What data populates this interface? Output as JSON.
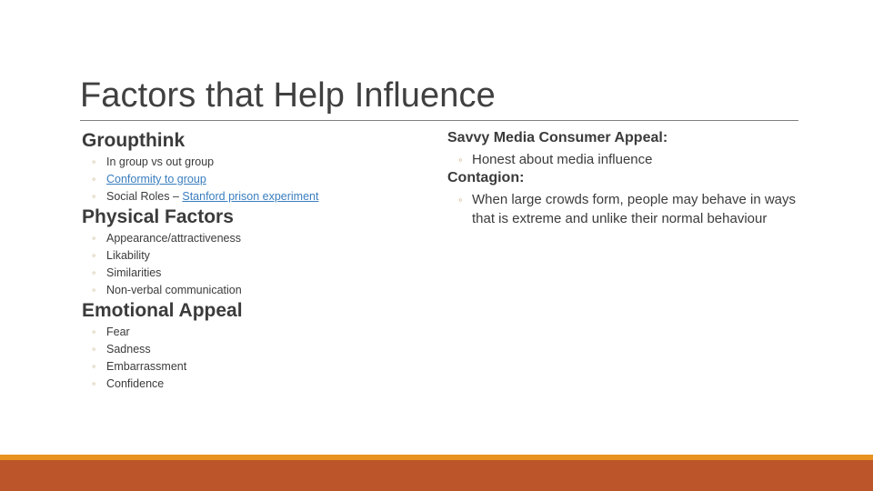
{
  "slide": {
    "title": "Factors that Help Influence",
    "colors": {
      "title_text": "#404040",
      "body_text": "#3b3b3b",
      "bullet_marker": "#bfa97a",
      "hyperlink": "#3a7ebf",
      "rule": "#808080",
      "accent_amber": "#e8921f",
      "accent_rust": "#bd552b"
    },
    "bullet_glyph": "◦"
  },
  "left_column": {
    "sections": [
      {
        "heading": "Groupthink",
        "bullets": [
          {
            "text": "In group vs out group",
            "link": false
          },
          {
            "text": "Conformity to group",
            "link": true
          },
          {
            "prefix": "Social Roles – ",
            "link_text": "Stanford prison experiment",
            "link": "partial"
          }
        ]
      },
      {
        "heading": "Physical Factors",
        "bullets": [
          {
            "text": "Appearance/attractiveness",
            "link": false
          },
          {
            "text": "Likability",
            "link": false
          },
          {
            "text": "Similarities",
            "link": false
          },
          {
            "text": "Non-verbal communication",
            "link": false
          }
        ]
      },
      {
        "heading": "Emotional Appeal",
        "bullets": [
          {
            "text": "Fear",
            "link": false
          },
          {
            "text": "Sadness",
            "link": false
          },
          {
            "text": "Embarrassment",
            "link": false
          },
          {
            "text": "Confidence",
            "link": false
          }
        ]
      }
    ]
  },
  "right_column": {
    "sections": [
      {
        "heading": "Savvy Media Consumer Appeal:",
        "bullets": [
          {
            "text": "Honest about media influence",
            "link": false
          }
        ]
      },
      {
        "heading": "Contagion:",
        "bullets": [
          {
            "text": "When large crowds form, people may behave in ways that is extreme and unlike their normal behaviour",
            "link": false
          }
        ]
      }
    ]
  }
}
